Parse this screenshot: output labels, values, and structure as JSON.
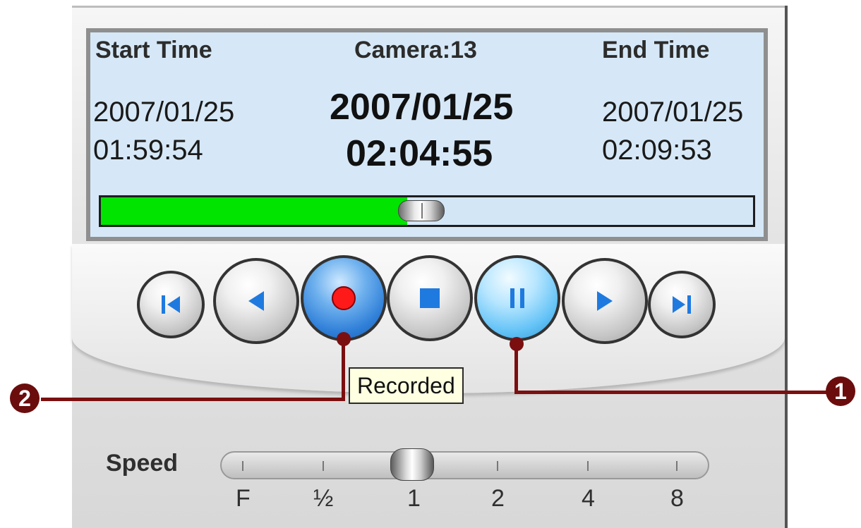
{
  "display": {
    "start_label": "Start Time",
    "camera_label": "Camera:13",
    "end_label": "End Time",
    "start_date": "2007/01/25",
    "start_time": "01:59:54",
    "current_date": "2007/01/25",
    "current_time": "02:04:55",
    "end_date": "2007/01/25",
    "end_time": "02:09:53",
    "progress_fraction": 0.47
  },
  "controls": {
    "buttons": [
      {
        "name": "skip-to-start-button",
        "icon": "skip-start-icon",
        "style": "grey"
      },
      {
        "name": "play-reverse-button",
        "icon": "play-reverse-icon",
        "style": "grey"
      },
      {
        "name": "record-button",
        "icon": "record-icon",
        "style": "blue"
      },
      {
        "name": "stop-button",
        "icon": "stop-icon",
        "style": "grey"
      },
      {
        "name": "pause-button",
        "icon": "pause-icon",
        "style": "lightblue"
      },
      {
        "name": "play-forward-button",
        "icon": "play-icon",
        "style": "grey"
      },
      {
        "name": "skip-to-end-button",
        "icon": "skip-end-icon",
        "style": "grey"
      }
    ],
    "tooltip": "Recorded"
  },
  "callouts": [
    {
      "number": "2"
    },
    {
      "number": "1"
    }
  ],
  "speed": {
    "label": "Speed",
    "ticks": [
      "F",
      "½",
      "1",
      "2",
      "4",
      "8"
    ],
    "selected": "1"
  },
  "colors": {
    "progress_fill": "#00e400",
    "display_bg": "#d6e8f7",
    "callout": "#7b0f0f"
  }
}
